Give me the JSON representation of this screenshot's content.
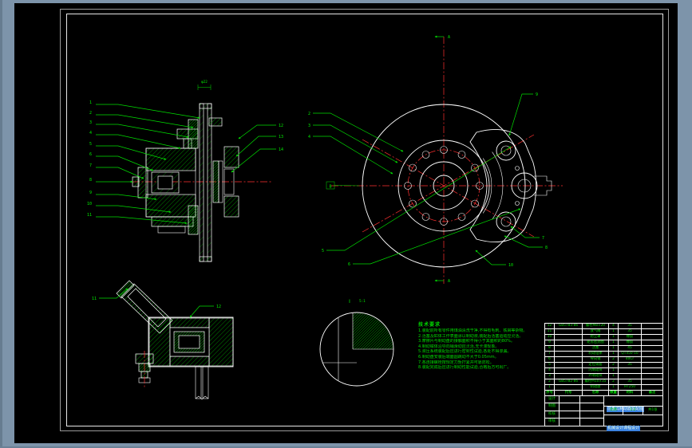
{
  "window": {
    "background": "#7d94aa",
    "sheet": "#000000"
  },
  "drawing": {
    "line_color": "#ffffff",
    "annotation_color": "#00dd00",
    "centerline_color": "#ff3030",
    "highlight_color": "#3b82e0",
    "section_view": {
      "dim_top": "φ22",
      "balloons_left": [
        "1",
        "2",
        "3",
        "4",
        "5",
        "6",
        "7",
        "8",
        "9",
        "10",
        "11"
      ],
      "balloons_right": [
        "12",
        "13",
        "14"
      ]
    },
    "front_view": {
      "section_label": "A",
      "datum": "B",
      "balloons_left": [
        "2",
        "3",
        "4"
      ],
      "balloons_lower": [
        "5",
        "6"
      ],
      "balloons_right": [
        "7",
        "8"
      ],
      "balloon_top": "9",
      "balloon_bottom": "10"
    },
    "bottom_view": {
      "balloons": [
        "11",
        "12"
      ]
    },
    "detail_view": {
      "label": "I",
      "scale": "5:1"
    }
  },
  "notes": {
    "title": "技术要求",
    "lines": [
      "1.装配前所有零件用煤油清洗干净,不得有毛刺、铁屑等杂物。",
      "2.活塞及缸体工作表面涂以制动液,装配后活塞运动应灵活。",
      "3.摩擦片与制动盘的接触面积不得小于其面积的80%。",
      "4.制动钳体沿导向销滑动应灵活,无卡滞现象。",
      "5.液压系统装配后应进行密封性试验,各处不得渗漏。",
      "6.制动盘安装后端面圆跳动不大于0.05mm。",
      "7.各连接螺栓按规定力矩拧紧并可靠防松。",
      "8.装配完成后应进行制动性能试验,合格后方可出厂。"
    ]
  },
  "title_block": {
    "bom": {
      "headers": [
        "序号",
        "代号",
        "名称",
        "数量",
        "材料",
        "备注"
      ],
      "rows": [
        [
          "12",
          "GB5783-86",
          "螺栓M8×20",
          "4",
          "35",
          ""
        ],
        [
          "11",
          "",
          "放气阀",
          "1",
          "35",
          ""
        ],
        [
          "10",
          "",
          "防尘罩",
          "1",
          "橡胶",
          ""
        ],
        [
          "9",
          "",
          "矩形密封圈",
          "1",
          "橡胶",
          ""
        ],
        [
          "8",
          "",
          "活塞",
          "1",
          "45",
          ""
        ],
        [
          "7",
          "",
          "制动钳体",
          "1",
          "QT450-10",
          ""
        ],
        [
          "6",
          "",
          "导向销",
          "2",
          "40Cr",
          ""
        ],
        [
          "5",
          "",
          "定位销套",
          "2",
          "35",
          ""
        ],
        [
          "4",
          "",
          "内制动块",
          "1",
          "",
          ""
        ],
        [
          "3",
          "",
          "外制动块",
          "1",
          "",
          ""
        ],
        [
          "2",
          "GB5782-86",
          "螺栓M10×35",
          "2",
          "35",
          ""
        ],
        [
          "1",
          "",
          "制动盘",
          "1",
          "HT250",
          ""
        ]
      ]
    },
    "info": {
      "row_labels": [
        "设计",
        "制图",
        "校核",
        "审核"
      ],
      "mid_cells": [
        "比例",
        "1:2",
        "共1张"
      ],
      "title_text": "前盘式制动器装配图",
      "org_text": "机械设计课程设计"
    }
  }
}
